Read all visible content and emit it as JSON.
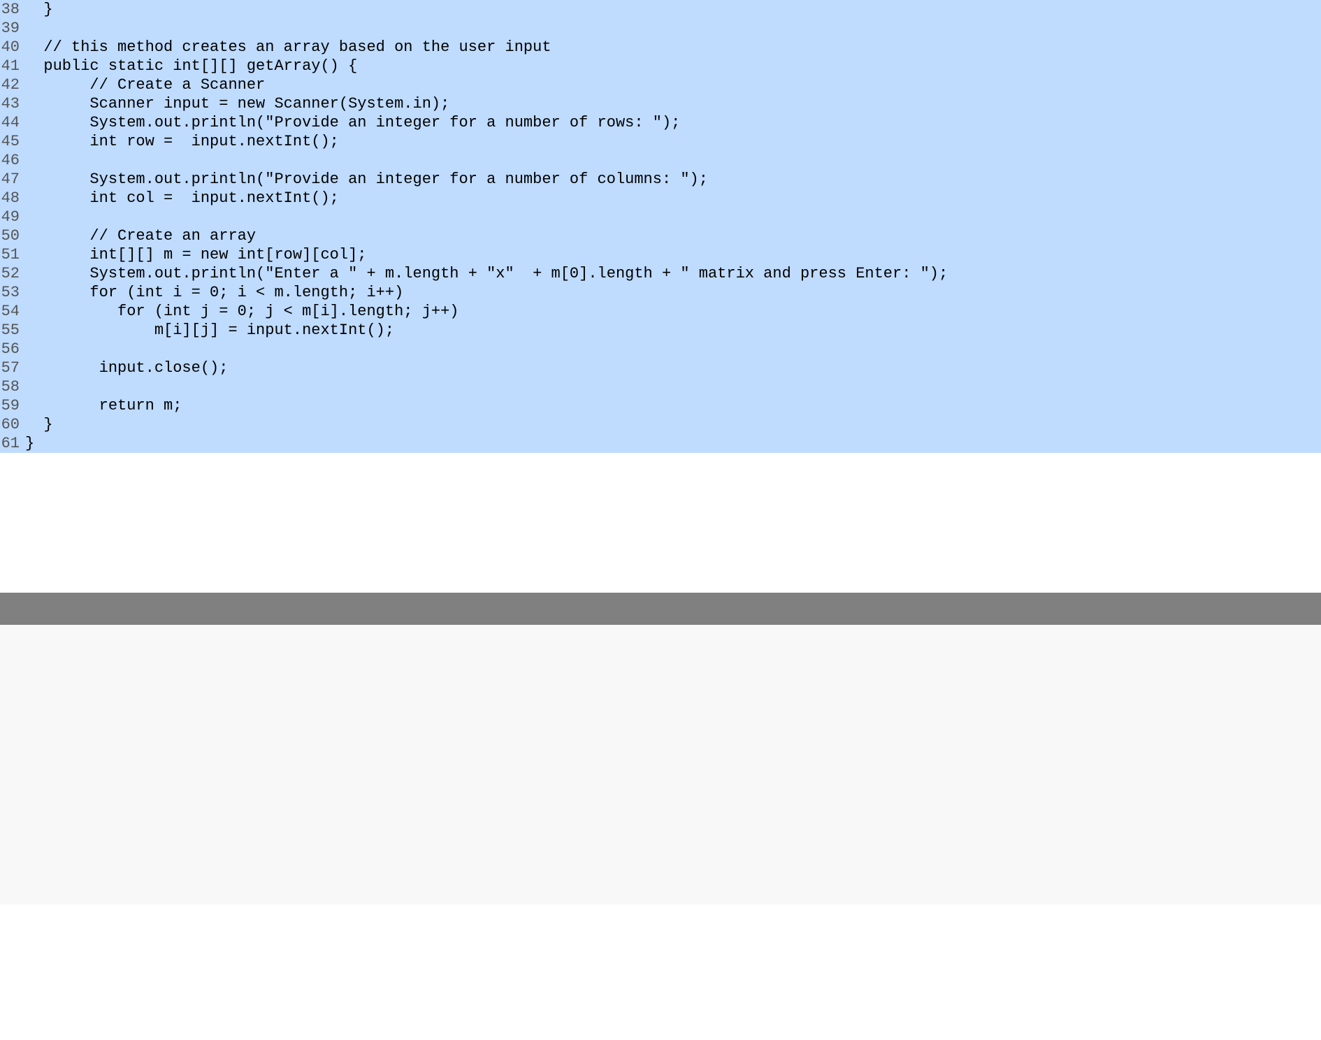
{
  "code": {
    "lines": [
      {
        "num": "38",
        "text": "  }"
      },
      {
        "num": "39",
        "text": ""
      },
      {
        "num": "40",
        "text": "  // this method creates an array based on the user input"
      },
      {
        "num": "41",
        "text": "  public static int[][] getArray() {"
      },
      {
        "num": "42",
        "text": "       // Create a Scanner"
      },
      {
        "num": "43",
        "text": "       Scanner input = new Scanner(System.in);"
      },
      {
        "num": "44",
        "text": "       System.out.println(\"Provide an integer for a number of rows: \");"
      },
      {
        "num": "45",
        "text": "       int row =  input.nextInt();"
      },
      {
        "num": "46",
        "text": ""
      },
      {
        "num": "47",
        "text": "       System.out.println(\"Provide an integer for a number of columns: \");"
      },
      {
        "num": "48",
        "text": "       int col =  input.nextInt();"
      },
      {
        "num": "49",
        "text": ""
      },
      {
        "num": "50",
        "text": "       // Create an array"
      },
      {
        "num": "51",
        "text": "       int[][] m = new int[row][col];"
      },
      {
        "num": "52",
        "text": "       System.out.println(\"Enter a \" + m.length + \"x\"  + m[0].length + \" matrix and press Enter: \");"
      },
      {
        "num": "53",
        "text": "       for (int i = 0; i < m.length; i++)"
      },
      {
        "num": "54",
        "text": "          for (int j = 0; j < m[i].length; j++)"
      },
      {
        "num": "55",
        "text": "              m[i][j] = input.nextInt();"
      },
      {
        "num": "56",
        "text": ""
      },
      {
        "num": "57",
        "text": "        input.close();"
      },
      {
        "num": "58",
        "text": ""
      },
      {
        "num": "59",
        "text": "        return m;"
      },
      {
        "num": "60",
        "text": "  }"
      },
      {
        "num": "61",
        "text": "}"
      }
    ]
  }
}
